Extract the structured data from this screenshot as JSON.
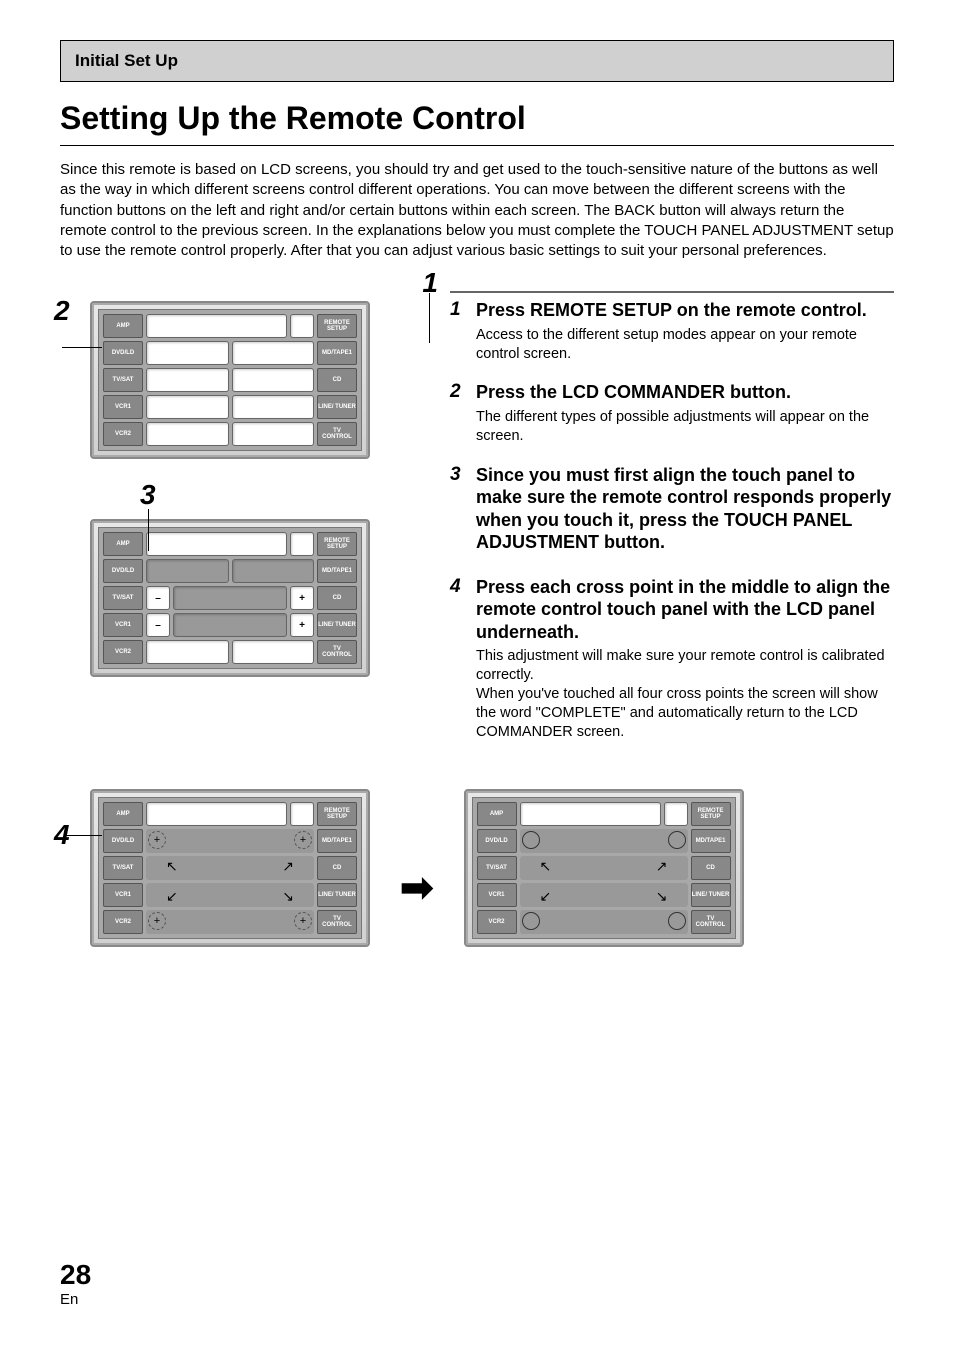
{
  "header": "Initial Set Up",
  "title": "Setting Up the Remote Control",
  "intro": "Since this remote is based on LCD screens, you should try and get used to the touch-sensitive nature of the buttons as well as the way in which different screens control different operations. You can move between the different screens with the function buttons on the left and right and/or certain buttons within each screen. The BACK button will always return the remote control to the previous screen. In the explanations below you must complete the TOUCH PANEL ADJUSTMENT setup to use the remote control properly. After that you can adjust various basic settings to suit your personal preferences.",
  "callouts": {
    "c1": "1",
    "c2": "2",
    "c3": "3",
    "c4": "4"
  },
  "steps": [
    {
      "num": "1",
      "head": "Press REMOTE SETUP on the remote control.",
      "desc": "Access to the different setup modes appear on your remote control screen."
    },
    {
      "num": "2",
      "head": "Press the LCD COMMANDER button.",
      "desc": "The different types of possible adjustments will appear on the screen."
    },
    {
      "num": "3",
      "head": "Since you must first align the touch panel to make sure the remote control responds properly when you touch it, press the TOUCH PANEL ADJUSTMENT button.",
      "desc": ""
    },
    {
      "num": "4",
      "head": "Press each cross point in the middle to align the remote  control touch panel with the LCD panel underneath.",
      "desc": "This adjustment will make sure your remote control is calibrated correctly.\nWhen you've touched all four cross points the screen will show the word \"COMPLETE\" and automatically return to the LCD COMMANDER screen."
    }
  ],
  "remote_labels": {
    "left": [
      "AMP",
      "DVD/LD",
      "TV/SAT",
      "VCR1",
      "VCR2"
    ],
    "right": [
      "REMOTE SETUP",
      "MD/TAPE1",
      "CD",
      "LINE/ TUNER",
      "TV CONTROL"
    ]
  },
  "symbols": {
    "minus": "–",
    "plus": "+",
    "arrow": "➡"
  },
  "page": {
    "num": "28",
    "lang": "En"
  }
}
